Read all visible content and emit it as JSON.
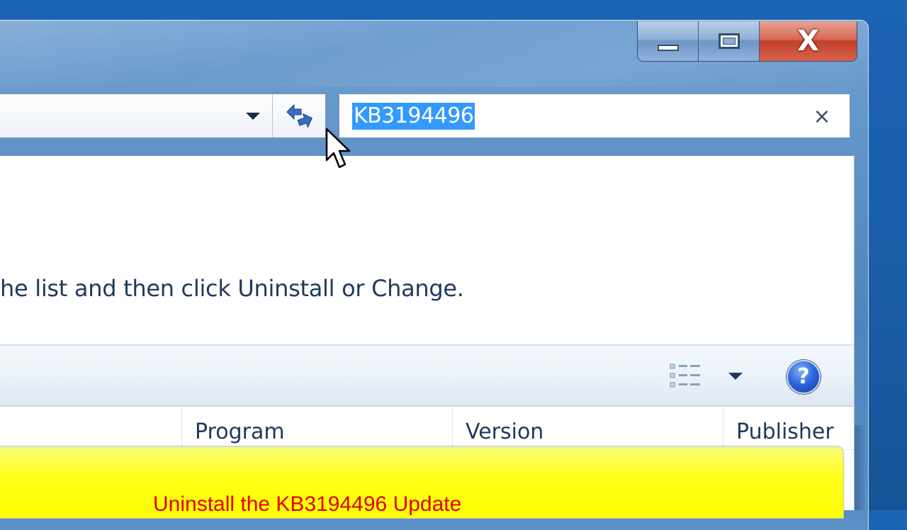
{
  "window": {
    "caption": {
      "minimize_icon": "minimize-icon",
      "maximize_icon": "maximize-icon",
      "close_glyph": "X"
    }
  },
  "address_bar": {
    "dropdown_icon": "chevron-down-icon",
    "refresh_icon": "refresh-icon"
  },
  "search": {
    "value": "KB3194496",
    "clear_glyph": "×"
  },
  "main": {
    "instruction": "he list and then click Uninstall or Change."
  },
  "toolbar": {
    "view_icon": "view-details-icon",
    "view_dropdown_icon": "chevron-down-icon",
    "help_glyph": "?"
  },
  "columns": [
    {
      "label": "Program"
    },
    {
      "label": "Version"
    },
    {
      "label": "Publisher"
    }
  ],
  "overlay": {
    "caption": "Uninstall the KB3194496 Update"
  },
  "colors": {
    "accent": "#3399ff",
    "caption_text": "#e00000",
    "caption_bg": "#ffff00",
    "close_button": "#c2402a"
  }
}
